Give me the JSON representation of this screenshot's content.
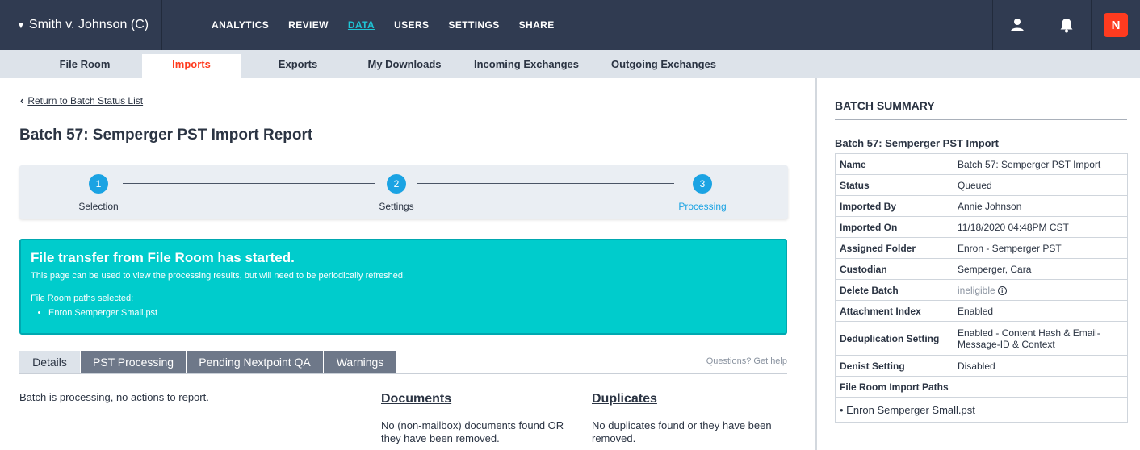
{
  "topbar": {
    "case_name": "Smith v. Johnson (C)",
    "nav": [
      "ANALYTICS",
      "REVIEW",
      "DATA",
      "USERS",
      "SETTINGS",
      "SHARE"
    ],
    "active_nav": "DATA",
    "logo_text": "N"
  },
  "subnav": {
    "tabs": [
      "File Room",
      "Imports",
      "Exports",
      "My Downloads",
      "Incoming Exchanges",
      "Outgoing Exchanges"
    ],
    "active": "Imports"
  },
  "main": {
    "back_link": "Return to Batch Status List",
    "title": "Batch 57: Semperger PST Import Report",
    "steps": [
      {
        "num": "1",
        "label": "Selection"
      },
      {
        "num": "2",
        "label": "Settings"
      },
      {
        "num": "3",
        "label": "Processing"
      }
    ],
    "alert": {
      "heading": "File transfer from File Room has started.",
      "subtext": "This page can be used to view the processing results, but will need to be periodically refreshed.",
      "paths_label": "File Room paths selected:",
      "paths": [
        "Enron Semperger Small.pst"
      ]
    },
    "tabs": [
      "Details",
      "PST Processing",
      "Pending Nextpoint QA",
      "Warnings"
    ],
    "active_tab": "Details",
    "help_link": "Questions? Get help",
    "status_text": "Batch is processing, no actions to report.",
    "documents": {
      "heading": "Documents",
      "text": "No (non-mailbox) documents found OR they have been removed."
    },
    "duplicates": {
      "heading": "Duplicates",
      "text": "No duplicates found or they have been removed."
    }
  },
  "summary": {
    "title": "BATCH SUMMARY",
    "batch_name": "Batch 57: Semperger PST Import",
    "rows": [
      {
        "key": "Name",
        "value": "Batch 57: Semperger PST Import"
      },
      {
        "key": "Status",
        "value": "Queued"
      },
      {
        "key": "Imported By",
        "value": "Annie Johnson"
      },
      {
        "key": "Imported On",
        "value": "11/18/2020 04:48PM CST"
      },
      {
        "key": "Assigned Folder",
        "value": "Enron - Semperger PST"
      },
      {
        "key": "Custodian",
        "value": "Semperger, Cara"
      },
      {
        "key": "Delete Batch",
        "value": "ineligible"
      },
      {
        "key": "Attachment Index",
        "value": "Enabled"
      },
      {
        "key": "Deduplication Setting",
        "value": "Enabled - Content Hash & Email-Message-ID & Context"
      },
      {
        "key": "Denist Setting",
        "value": "Disabled"
      }
    ],
    "paths_label": "File Room Import Paths",
    "paths": [
      "Enron Semperger Small.pst"
    ]
  }
}
